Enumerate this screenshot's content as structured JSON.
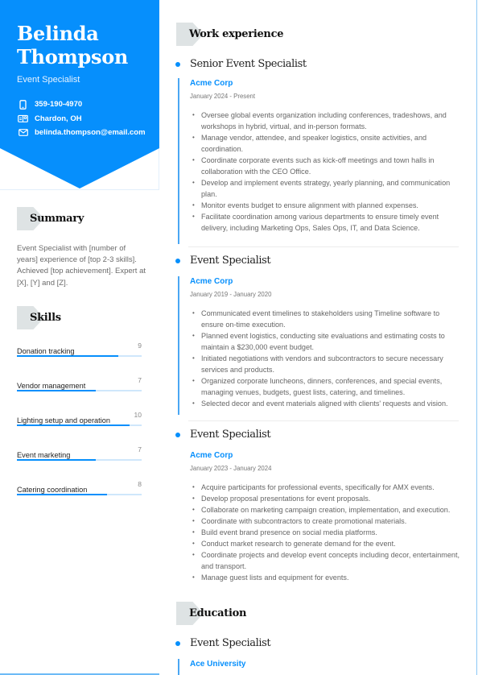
{
  "profile": {
    "first_name": "Belinda",
    "last_name": "Thompson",
    "role": "Event Specialist",
    "contacts": [
      {
        "icon": "phone-icon",
        "text": "359-190-4970"
      },
      {
        "icon": "location-icon",
        "text": "Chardon, OH"
      },
      {
        "icon": "email-icon",
        "text": "belinda.thompson@email.com"
      }
    ]
  },
  "colors": {
    "accent": "#068ffc",
    "badge": "#dee3e4",
    "bar_track": "#cfe7fb"
  },
  "summary": {
    "heading": "Summary",
    "text": "Event Specialist with [number of years] experience of [top 2-3 skills]. Achieved [top achievement]. Expert at [X], [Y] and [Z]."
  },
  "skills": {
    "heading": "Skills",
    "max": 10,
    "items": [
      {
        "name": "Donation tracking",
        "value": 9
      },
      {
        "name": "Vendor management",
        "value": 7
      },
      {
        "name": "Lighting setup and operation",
        "value": 10
      },
      {
        "name": "Event marketing",
        "value": 7
      },
      {
        "name": "Catering coordination",
        "value": 8
      }
    ]
  },
  "work": {
    "heading": "Work experience",
    "jobs": [
      {
        "title": "Senior Event Specialist",
        "company": "Acme Corp",
        "dates": "January 2024 - Present",
        "bullets": [
          "Oversee global events organization including conferences, tradeshows, and workshops in hybrid, virtual, and in-person formats.",
          "Manage vendor, attendee, and speaker logistics, onsite activities, and coordination.",
          "Coordinate corporate events such as kick-off meetings and town halls in collaboration with the CEO Office.",
          "Develop and implement events strategy, yearly planning, and communication plan.",
          "Monitor events budget to ensure alignment with planned expenses.",
          "Facilitate coordination among various departments to ensure timely event delivery, including Marketing Ops, Sales Ops, IT, and Data Science."
        ]
      },
      {
        "title": "Event Specialist",
        "company": "Acme Corp",
        "dates": "January 2019 - January 2020",
        "bullets": [
          "Communicated event timelines to stakeholders using Timeline software to ensure on-time execution.",
          "Planned event logistics, conducting site evaluations and estimating costs to maintain a $230,000 event budget.",
          "Initiated negotiations with vendors and subcontractors to secure necessary services and products.",
          "Organized corporate luncheons, dinners, conferences, and special events, managing venues, budgets, guest lists, catering, and timelines.",
          "Selected decor and event materials aligned with clients' requests and vision."
        ]
      },
      {
        "title": "Event Specialist",
        "company": "Acme Corp",
        "dates": "January 2023 - January 2024",
        "bullets": [
          "Acquire participants for professional events, specifically for AMX events.",
          "Develop proposal presentations for event proposals.",
          "Collaborate on marketing campaign creation, implementation, and execution.",
          "Coordinate with subcontractors to create promotional materials.",
          "Build event brand presence on social media platforms.",
          "Conduct market research to generate demand for the event.",
          "Coordinate projects and develop event concepts including decor, entertainment, and transport.",
          "Manage guest lists and equipment for events."
        ]
      }
    ]
  },
  "education": {
    "heading": "Education",
    "items": [
      {
        "title": "Event Specialist",
        "school": "Ace University"
      }
    ]
  }
}
